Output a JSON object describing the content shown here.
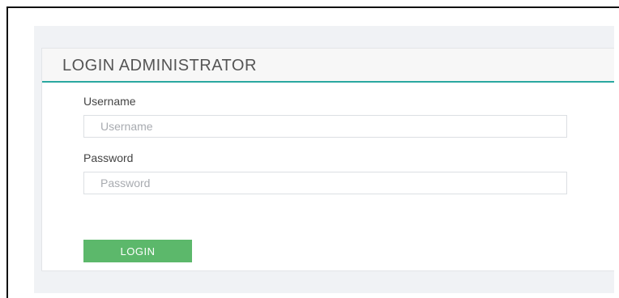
{
  "panel": {
    "title": "LOGIN ADMINISTRATOR"
  },
  "form": {
    "username": {
      "label": "Username",
      "placeholder": "Username",
      "value": ""
    },
    "password": {
      "label": "Password",
      "placeholder": "Password",
      "value": ""
    },
    "login_label": "LOGIN"
  },
  "colors": {
    "accent_border": "#2aa8a0",
    "login_button": "#5cb86b",
    "page_background": "#f0f2f5"
  }
}
